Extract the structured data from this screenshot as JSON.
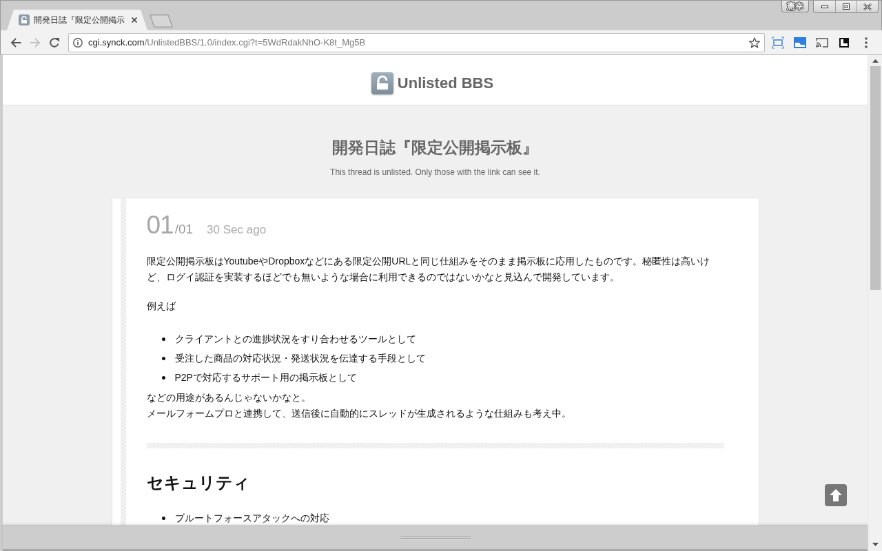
{
  "browser": {
    "tabs": [
      {
        "title": "開発日誌『限定公開掲示",
        "selected": true
      }
    ],
    "profile": "憲幸",
    "toolbar": {
      "buttons": [
        {
          "kind": "back",
          "disabled": false
        },
        {
          "kind": "forward",
          "disabled": true
        },
        {
          "kind": "reload",
          "disabled": false
        }
      ]
    },
    "address": {
      "host": "cgi.synck.com",
      "path": "/UnlistedBBS/1.0/index.cgi?t=5WdRdakNhO-K8t_Mg5B"
    }
  },
  "site": {
    "name": "Unlisted BBS"
  },
  "thread": {
    "title": "開発日誌『限定公開掲示板』",
    "notice": "This thread is unlisted. Only those with the link can see it."
  },
  "posts": [
    {
      "number": "01",
      "count": "/01",
      "time": "30 Sec ago",
      "blocks": [
        {
          "kind": "paragraph",
          "text": "限定公開掲示板はYoutubeやDropboxなどにある限定公開URLと同じ仕組みをそのまま掲示板に応用したものです。秘匿性は高いけど、ログイ認証を実装するほどでも無いような場合に利用できるのではないかなと見込んで開発しています。"
        },
        {
          "kind": "paragraph",
          "text": "例えば"
        },
        {
          "kind": "list",
          "items": [
            "クライアントとの進捗状況をすり合わせるツールとして",
            "受注した商品の対応状況・発送状況を伝達する手段として",
            "P2Pで対応するサポート用の掲示板として"
          ]
        },
        {
          "kind": "lines",
          "lines": [
            "などの用途があるんじゃないかなと。",
            "メールフォームプロと連携して、送信後に自動的にスレッドが生成されるような仕組みも考え中。"
          ]
        },
        {
          "kind": "rule"
        },
        {
          "kind": "heading",
          "text": "セキュリティ"
        },
        {
          "kind": "list",
          "items": [
            "ブルートフォースアタックへの対応"
          ]
        }
      ]
    }
  ]
}
